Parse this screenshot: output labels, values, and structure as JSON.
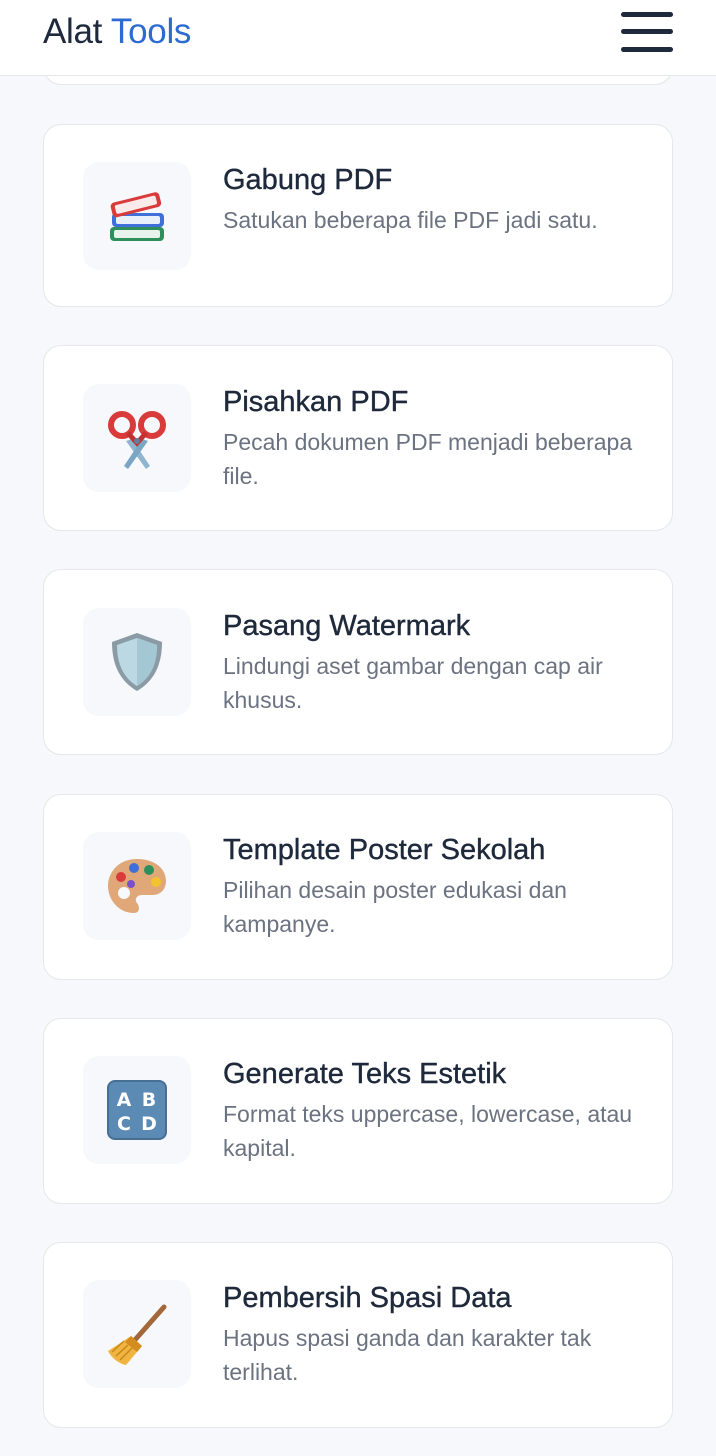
{
  "header": {
    "brand_primary": "Alat",
    "brand_accent": "Tools",
    "menu_icon": "hamburger-menu-icon"
  },
  "colors": {
    "accent": "#2d6ad1",
    "text": "#1e293b",
    "muted": "#6b7280",
    "background": "#f6f8fb",
    "card": "#ffffff",
    "border": "#e5e7eb"
  },
  "tools": [
    {
      "icon": "books-icon",
      "title": "Gabung PDF",
      "description": "Satukan beberapa file PDF jadi satu."
    },
    {
      "icon": "scissors-icon",
      "title": "Pisahkan PDF",
      "description": "Pecah dokumen PDF menjadi beberapa file."
    },
    {
      "icon": "shield-icon",
      "title": "Pasang Watermark",
      "description": "Lindungi aset gambar dengan cap air khusus."
    },
    {
      "icon": "palette-icon",
      "title": "Template Poster Sekolah",
      "description": "Pilihan desain poster edukasi dan kampanye."
    },
    {
      "icon": "abcd-icon",
      "title": "Generate Teks Estetik",
      "description": "Format teks uppercase, lowercase, atau kapital."
    },
    {
      "icon": "broom-icon",
      "title": "Pembersih Spasi Data",
      "description": "Hapus spasi ganda dan karakter tak terlihat."
    }
  ]
}
